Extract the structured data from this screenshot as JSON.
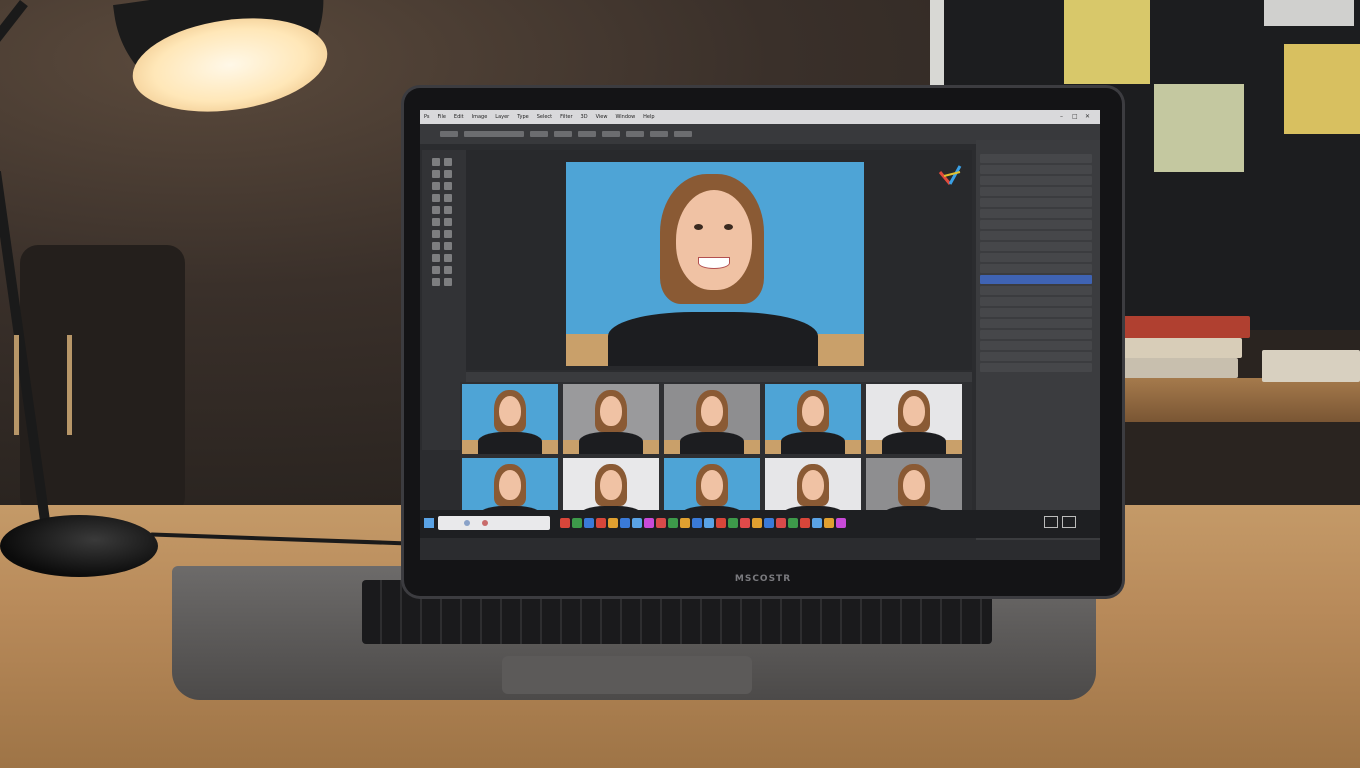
{
  "scene": {
    "description_labels": [],
    "laptop_logo": "MSCOSTR"
  },
  "app": {
    "menu": [
      "Ps",
      "File",
      "Edit",
      "Image",
      "Layer",
      "Type",
      "Select",
      "Filter",
      "3D",
      "View",
      "Window",
      "Help"
    ],
    "window_controls": [
      "–",
      "□",
      "✕"
    ],
    "canvas_note": "",
    "layers_panel_title": "",
    "layers": [
      {
        "label": "",
        "selected": false
      },
      {
        "label": "",
        "selected": false
      },
      {
        "label": "",
        "selected": false
      },
      {
        "label": "",
        "selected": false
      },
      {
        "label": "",
        "selected": false
      },
      {
        "label": "",
        "selected": false
      },
      {
        "label": "",
        "selected": false
      },
      {
        "label": "",
        "selected": false
      },
      {
        "label": "",
        "selected": false
      },
      {
        "label": "",
        "selected": false
      },
      {
        "label": "",
        "selected": false
      },
      {
        "label": "",
        "selected": true
      },
      {
        "label": "",
        "selected": false
      },
      {
        "label": "",
        "selected": false
      },
      {
        "label": "",
        "selected": false
      },
      {
        "label": "",
        "selected": false
      },
      {
        "label": "",
        "selected": false
      },
      {
        "label": "",
        "selected": false
      },
      {
        "label": "",
        "selected": false
      },
      {
        "label": "",
        "selected": false
      }
    ],
    "thumbnails": [
      {
        "bg": "#4ea4d6"
      },
      {
        "bg": "#9a9a9c"
      },
      {
        "bg": "#8e8e90"
      },
      {
        "bg": "#4ea4d6"
      },
      {
        "bg": "#e6e6e8"
      },
      {
        "bg": "#4ea4d6"
      },
      {
        "bg": "#e8e8ea"
      },
      {
        "bg": "#4ea4d6"
      },
      {
        "bg": "#e6e6e8"
      },
      {
        "bg": "#8e8e90"
      }
    ],
    "taskbar_apps": [
      "#d8463a",
      "#3d9a4a",
      "#3a7ad8",
      "#d8463a",
      "#e0a030",
      "#3a7ad8",
      "#5aa3e6",
      "#c84ad8",
      "#d84a4a",
      "#3d9a4a",
      "#e0a030",
      "#3a7ad8",
      "#5aa3e6",
      "#d8463a",
      "#3d9a4a",
      "#e04a4a",
      "#e0a030",
      "#3a7ad8",
      "#d84a4a",
      "#3d9a4a",
      "#d8463a",
      "#5aa3e6",
      "#e0a030",
      "#c84ad8"
    ],
    "colors": {
      "accent": "#3f63b3",
      "backdrop": "#4ea4d6",
      "chrome": "#2b2c2f"
    }
  }
}
